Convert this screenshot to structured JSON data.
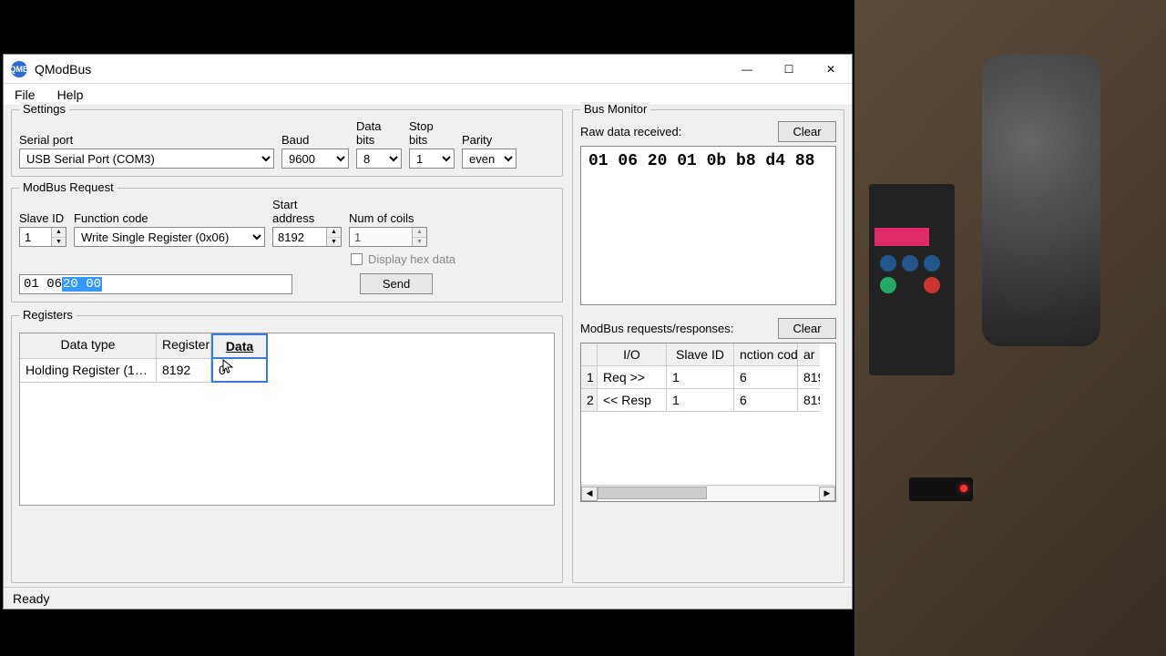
{
  "window": {
    "title": "QModBus",
    "icon_label": "QMB",
    "minimize": "—",
    "maximize": "☐",
    "close": "✕"
  },
  "menu": {
    "file": "File",
    "help": "Help"
  },
  "settings": {
    "group": "Settings",
    "serial_port_label": "Serial port",
    "serial_port_value": "USB Serial Port (COM3)",
    "baud_label": "Baud",
    "baud_value": "9600",
    "databits_label": "Data bits",
    "databits_value": "8",
    "stopbits_label": "Stop bits",
    "stopbits_value": "1",
    "parity_label": "Parity",
    "parity_value": "even"
  },
  "request": {
    "group": "ModBus Request",
    "slave_id_label": "Slave ID",
    "slave_id_value": "1",
    "func_label": "Function code",
    "func_value": "Write Single Register (0x06)",
    "start_label": "Start address",
    "start_value": "8192",
    "num_label": "Num of coils",
    "num_value": "1",
    "hex_checkbox": "Display hex data",
    "raw_prefix": "01  06  ",
    "raw_selected": "20  00",
    "send": "Send"
  },
  "registers": {
    "group": "Registers",
    "headers": {
      "type": "Data type",
      "reg": "Register",
      "data": "Data"
    },
    "row": {
      "type": "Holding Register (1…",
      "reg": "8192",
      "data": "0"
    }
  },
  "monitor": {
    "group": "Bus Monitor",
    "raw_label": "Raw data received:",
    "clear": "Clear",
    "raw_data": "01 06 20 01 0b b8 d4 88",
    "req_label": "ModBus requests/responses:",
    "headers": {
      "io": "I/O",
      "slave": "Slave ID",
      "func": "nction cod",
      "addr": "ar"
    },
    "rows": [
      {
        "n": "1",
        "io": "Req >>",
        "slave": "1",
        "func": "6",
        "addr": "819"
      },
      {
        "n": "2",
        "io": "<< Resp",
        "slave": "1",
        "func": "6",
        "addr": "819"
      }
    ],
    "scroll_left": "◀",
    "scroll_right": "▶"
  },
  "status": "Ready"
}
